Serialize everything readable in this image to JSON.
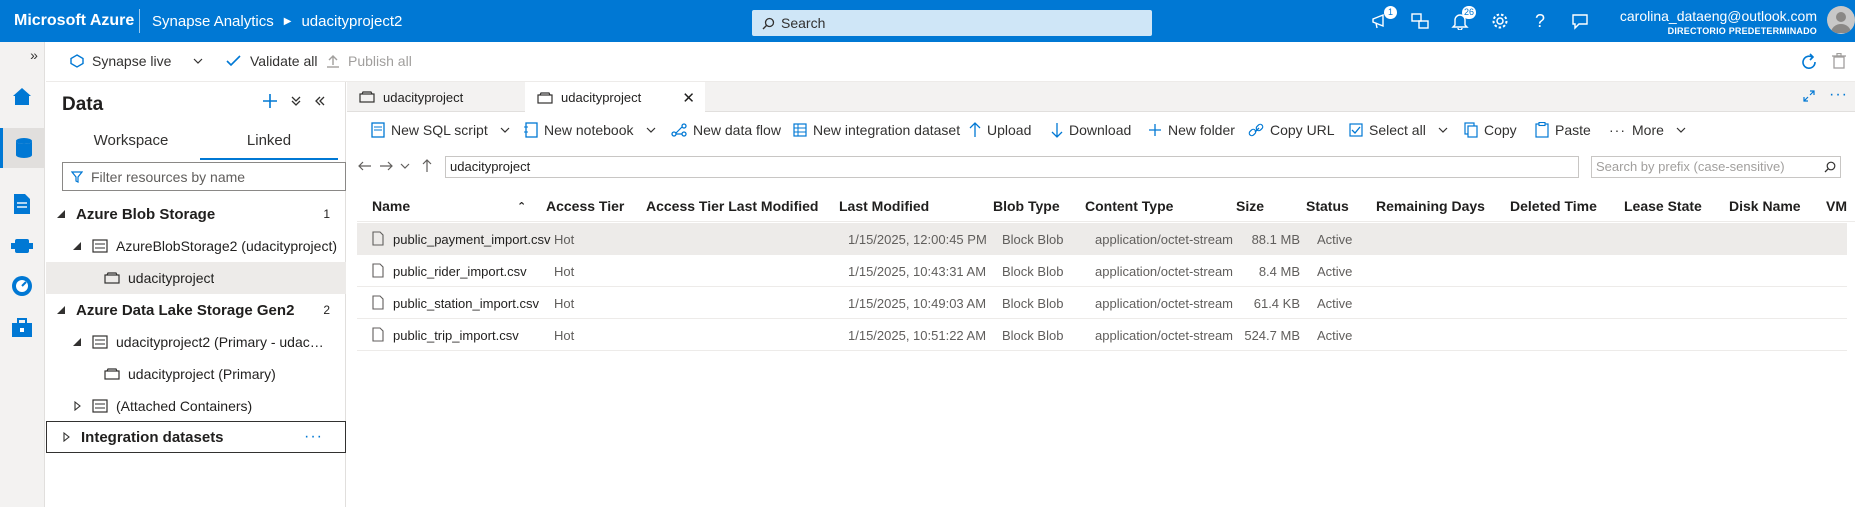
{
  "topbar": {
    "brand": "Microsoft Azure",
    "product": "Synapse Analytics",
    "workspace": "udacityproject2",
    "search_placeholder": "Search",
    "notification_badge_1": "1",
    "notification_badge_2": "26",
    "account_email": "carolina_dataeng@outlook.com",
    "account_directory": "DIRECTORIO PREDETERMINADO"
  },
  "commandbar": {
    "synapse_live": "Synapse live",
    "validate_all": "Validate all",
    "publish_all": "Publish all"
  },
  "datapanel": {
    "title": "Data",
    "tabs": [
      "Workspace",
      "Linked"
    ],
    "active_tab": "Linked",
    "filter_placeholder": "Filter resources by name",
    "tree": {
      "blob_storage": {
        "label": "Azure Blob Storage",
        "count": "1"
      },
      "blob_account": "AzureBlobStorage2 (udacityproject)",
      "blob_container": "udacityproject",
      "adls": {
        "label": "Azure Data Lake Storage Gen2",
        "count": "2"
      },
      "adls_account": "udacityproject2 (Primary - udacityp...",
      "adls_container": "udacityproject (Primary)",
      "attached": "(Attached Containers)",
      "integration": "Integration datasets"
    }
  },
  "doctabs": [
    "udacityproject",
    "udacityproject"
  ],
  "toolbar": {
    "new_sql_script": "New SQL script",
    "new_notebook": "New notebook",
    "new_data_flow": "New data flow",
    "new_integration_dataset": "New integration dataset",
    "upload": "Upload",
    "download": "Download",
    "new_folder": "New folder",
    "copy_url": "Copy URL",
    "select_all": "Select all",
    "copy": "Copy",
    "paste": "Paste",
    "more": "More"
  },
  "path": {
    "current": "udacityproject",
    "prefix_placeholder": "Search by prefix (case-sensitive)"
  },
  "table": {
    "columns": [
      "Name",
      "Access Tier",
      "Access Tier Last Modified",
      "Last Modified",
      "Blob Type",
      "Content Type",
      "Size",
      "Status",
      "Remaining Days",
      "Deleted Time",
      "Lease State",
      "Disk Name",
      "VM"
    ],
    "rows": [
      {
        "name": "public_payment_import.csv",
        "tier": "Hot",
        "modified": "1/15/2025, 12:00:45 PM",
        "blob_type": "Block Blob",
        "content_type": "application/octet-stream",
        "size": "88.1 MB",
        "status": "Active"
      },
      {
        "name": "public_rider_import.csv",
        "tier": "Hot",
        "modified": "1/15/2025, 10:43:31 AM",
        "blob_type": "Block Blob",
        "content_type": "application/octet-stream",
        "size": "8.4 MB",
        "status": "Active"
      },
      {
        "name": "public_station_import.csv",
        "tier": "Hot",
        "modified": "1/15/2025, 10:49:03 AM",
        "blob_type": "Block Blob",
        "content_type": "application/octet-stream",
        "size": "61.4 KB",
        "status": "Active"
      },
      {
        "name": "public_trip_import.csv",
        "tier": "Hot",
        "modified": "1/15/2025, 10:51:22 AM",
        "blob_type": "Block Blob",
        "content_type": "application/octet-stream",
        "size": "524.7 MB",
        "status": "Active"
      }
    ]
  },
  "colors": {
    "accent": "#0078d4",
    "selected_row": "#edebe9"
  }
}
